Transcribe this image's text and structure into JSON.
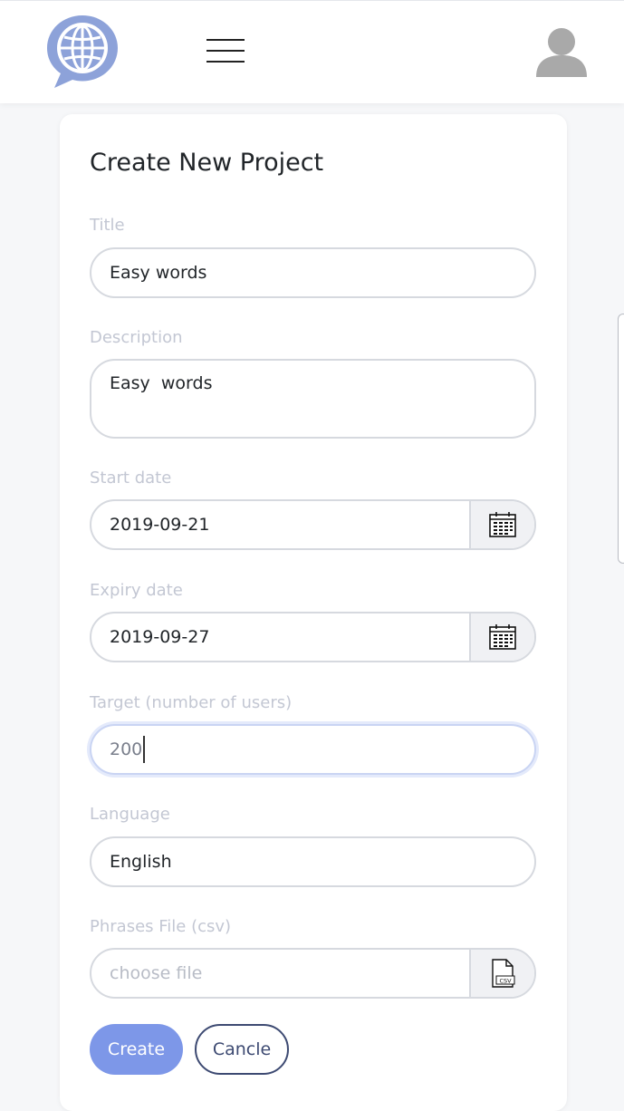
{
  "header": {
    "logo_icon": "globe-chat-bubble-icon",
    "menu_icon": "hamburger-menu-icon",
    "avatar_icon": "user-avatar-icon",
    "brand_color": "#8da2d9"
  },
  "form": {
    "title": "Create New Project",
    "fields": {
      "title": {
        "label": "Title",
        "value": "Easy words"
      },
      "description": {
        "label": "Description",
        "value": "Easy  words"
      },
      "start_date": {
        "label": "Start date",
        "value": "2019-09-21",
        "icon": "calendar-icon"
      },
      "expiry_date": {
        "label": "Expiry date",
        "value": "2019-09-27",
        "icon": "calendar-icon"
      },
      "target": {
        "label": "Target (number of users)",
        "value": "200"
      },
      "language": {
        "label": "Language",
        "value": "English"
      },
      "phrases_file": {
        "label": "Phrases File (csv)",
        "placeholder": "choose file",
        "icon": "csv-file-icon",
        "icon_text": "CSV"
      }
    },
    "buttons": {
      "create": "Create",
      "cancel": "Cancle"
    },
    "colors": {
      "primary": "#7d97e8",
      "secondary_border": "#3d4a72",
      "label": "#c3c7d3"
    }
  }
}
